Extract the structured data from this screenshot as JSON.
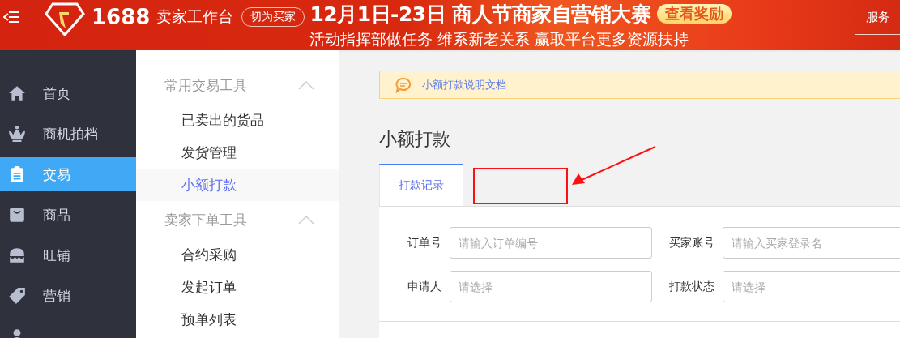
{
  "header": {
    "logo_number": "1688",
    "logo_title": "卖家工作台",
    "switch_button": "切为买家",
    "banner_title": "12月1日-23日 商人节商家自营销大赛",
    "banner_badge": "查看奖励",
    "banner_subtitle": "活动指挥部做任务 维系新老关系 赢取平台更多资源扶持",
    "service_button": "服务"
  },
  "sidebar": {
    "items": [
      {
        "label": "首页",
        "kind": "home",
        "selected": false
      },
      {
        "label": "商机拍档",
        "kind": "crown",
        "selected": false
      },
      {
        "label": "交易",
        "kind": "clipboard",
        "selected": true
      },
      {
        "label": "商品",
        "kind": "bag",
        "selected": false
      },
      {
        "label": "旺铺",
        "kind": "shop",
        "selected": false
      },
      {
        "label": "营销",
        "kind": "tag",
        "selected": false
      },
      {
        "kind": "person",
        "selected": false
      }
    ]
  },
  "subnav": {
    "groups": [
      {
        "title": "常用交易工具",
        "expanded": true,
        "items": [
          {
            "label": "已卖出的货品",
            "selected": false
          },
          {
            "label": "发货管理",
            "selected": false
          },
          {
            "label": "小额打款",
            "selected": true
          }
        ]
      },
      {
        "title": "卖家下单工具",
        "expanded": true,
        "items": [
          {
            "label": "合约采购",
            "selected": false
          },
          {
            "label": "发起订单",
            "selected": false
          },
          {
            "label": "预单列表",
            "selected": false
          }
        ]
      }
    ]
  },
  "notice": {
    "link": "小额打款说明文档"
  },
  "page_title": "小额打款",
  "tabs": [
    {
      "label": "打款记录",
      "selected": true
    }
  ],
  "form": {
    "fields": [
      {
        "label": "订单号",
        "placeholder": "请输入订单编号"
      },
      {
        "label": "买家账号",
        "placeholder": "请输入买家登录名"
      },
      {
        "label": "申请人",
        "placeholder": "请选择"
      },
      {
        "label": "打款状态",
        "placeholder": "请选择"
      }
    ]
  }
}
